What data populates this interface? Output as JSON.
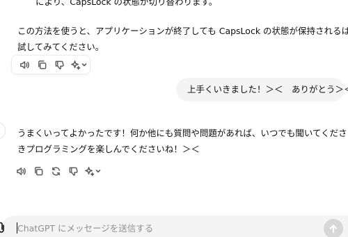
{
  "conversation": {
    "assistant_cut_line": "により、CapsLock の状態が切り替わります。",
    "assistant_message_1": {
      "line1": "この方法を使うと、アプリケーションが終了しても CapsLock の状態が保持されるはずです。",
      "line2": "試してみてください。"
    },
    "user_message": "上手くいきました！＞＜　ありがとう＞＜",
    "assistant_message_2": {
      "line1": "うまくいってよかったです！何か他にも質問や問題があれば、いつでも聞いてください。引き続",
      "line2": "きプログラミングを楽しんでくださいね！＞＜"
    }
  },
  "action_bar_1_icons": [
    "speaker-icon",
    "copy-icon",
    "thumbs-down-icon",
    "sparkle-icon",
    "chevron-down-icon"
  ],
  "action_bar_2_icons": [
    "speaker-icon",
    "copy-icon",
    "regenerate-icon",
    "thumbs-down-icon",
    "sparkle-icon",
    "chevron-down-icon"
  ],
  "composer": {
    "placeholder": "ChatGPT にメッセージを送信する",
    "value": ""
  },
  "colors": {
    "bubble_bg": "#f4f4f4",
    "icon": "#5d5d5d",
    "send_disabled": "#d7d7d7",
    "placeholder": "#8f8f8f"
  }
}
